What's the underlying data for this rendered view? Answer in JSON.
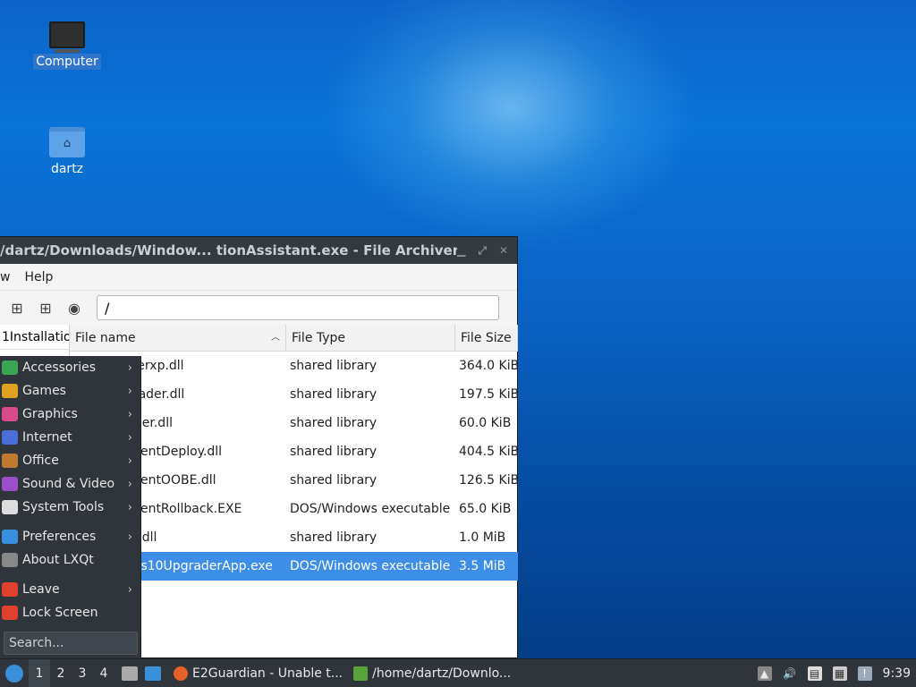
{
  "desktop": {
    "icons": [
      {
        "label": "Computer"
      },
      {
        "label": "dartz"
      }
    ]
  },
  "window": {
    "title": "/dartz/Downloads/Window...  tionAssistant.exe - File Archiver",
    "menus": [
      "w",
      "Help"
    ],
    "path": "/",
    "sidebar_item": "1Installatio",
    "columns": {
      "name": "File name",
      "type": "File Type",
      "size": "File Size"
    },
    "rows": [
      {
        "name": "serxp.dll",
        "type": "shared library",
        "size": "364.0 KiB"
      },
      {
        "name": "oader.dll",
        "type": "shared library",
        "size": "197.5 KiB"
      },
      {
        "name": "lper.dll",
        "type": "shared library",
        "size": "60.0 KiB"
      },
      {
        "name": "rrentDeploy.dll",
        "type": "shared library",
        "size": "404.5 KiB"
      },
      {
        "name": "rrentOOBE.dll",
        "type": "shared library",
        "size": "126.5 KiB"
      },
      {
        "name": "rrentRollback.EXE",
        "type": "DOS/Windows executable",
        "size": "65.0 KiB"
      },
      {
        "name": "o.dll",
        "type": "shared library",
        "size": "1.0 MiB"
      },
      {
        "name": "ws10UpgraderApp.exe",
        "type": "DOS/Windows executable",
        "size": "3.5 MiB"
      }
    ]
  },
  "appmenu": {
    "items": [
      {
        "label": "Accessories",
        "color": "#3aa655"
      },
      {
        "label": "Games",
        "color": "#e0a020"
      },
      {
        "label": "Graphics",
        "color": "#d84b8a"
      },
      {
        "label": "Internet",
        "color": "#4a6fd8"
      },
      {
        "label": "Office",
        "color": "#c07a30"
      },
      {
        "label": "Sound & Video",
        "color": "#9b4fc8"
      },
      {
        "label": "System Tools",
        "color": "#dddddd"
      }
    ],
    "items2": [
      {
        "label": "Preferences",
        "color": "#3a8ee0"
      },
      {
        "label": "About LXQt",
        "color": "#888888"
      }
    ],
    "items3": [
      {
        "label": "Leave",
        "color": "#e0402d"
      },
      {
        "label": "Lock Screen",
        "color": "#e0402d"
      }
    ],
    "search_placeholder": "Search..."
  },
  "taskbar": {
    "desktops": [
      "1",
      "2",
      "3",
      "4"
    ],
    "tasks": [
      {
        "label": "E2Guardian - Unable t..."
      },
      {
        "label": "/home/dartz/Downlo..."
      }
    ],
    "clock": "9:39"
  }
}
